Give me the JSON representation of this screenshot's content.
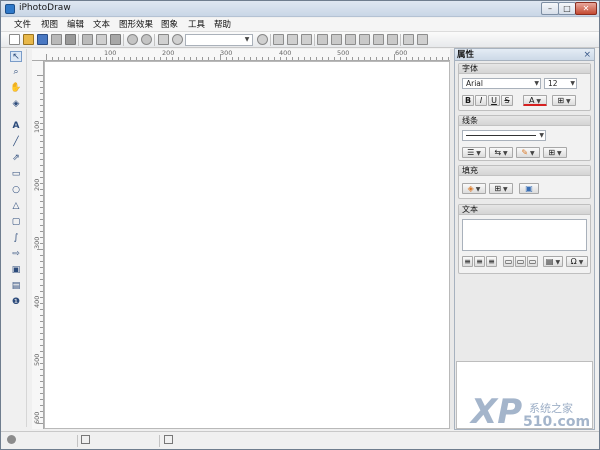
{
  "window": {
    "title": "iPhotoDraw",
    "controls": {
      "minimize": "–",
      "maximize": "□",
      "close": "✕"
    }
  },
  "menu": [
    "文件",
    "视图",
    "编辑",
    "文本",
    "图形效果",
    "图象",
    "工具",
    "帮助"
  ],
  "ruler": {
    "top_labels": [
      "100",
      "200",
      "300",
      "400",
      "500",
      "600"
    ],
    "left_labels": [
      "100",
      "200",
      "300",
      "400",
      "500",
      "600"
    ]
  },
  "panel": {
    "title": "属性",
    "close": "×",
    "font_group": {
      "heading": "字体",
      "font_name": "Arial",
      "font_size": "12",
      "bold": "B",
      "italic": "I",
      "underline": "U",
      "strike": "S",
      "color": "A"
    },
    "line_group": {
      "heading": "线条"
    },
    "fill_group": {
      "heading": "填充"
    },
    "text_group": {
      "heading": "文本",
      "symbol": "Ω"
    }
  },
  "logo": {
    "text": "XP",
    "subtext": "510.com",
    "tagline": "系统之家"
  },
  "colors": {
    "accent": "#2f79c9",
    "panel_header": "#cdd9e7",
    "text_color_bar": "#d62020",
    "fill_color": "#d97a2a"
  }
}
